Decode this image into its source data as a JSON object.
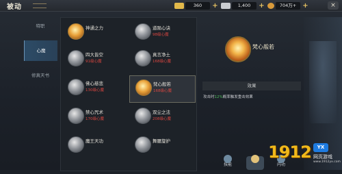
{
  "header": {
    "title": "被动",
    "resources": [
      {
        "icon": "gold-ingot-icon",
        "value": "360",
        "color": "#e2b94a"
      },
      {
        "icon": "silver-ingot-icon",
        "value": "1,400",
        "color": "#c9ccd0"
      },
      {
        "icon": "coin-bag-icon",
        "value": "704万+",
        "color": "#d89a3a"
      }
    ],
    "close_label": "×"
  },
  "sidebar": {
    "tabs": [
      {
        "label": "特职",
        "active": false
      },
      {
        "label": "心魔",
        "active": true
      },
      {
        "label": "修真天书",
        "active": false
      }
    ]
  },
  "skills": [
    {
      "name": "神通之力",
      "req": "",
      "icon": "fire-skill-icon",
      "style": "gold"
    },
    {
      "name": "道陨心诀",
      "req": "98级心魔",
      "icon": "orb-skill-icon",
      "style": "grey"
    },
    {
      "name": "四大皆空",
      "req": "91级心魔",
      "icon": "wind-skill-icon",
      "style": "grey"
    },
    {
      "name": "真言净土",
      "req": "168级心魔",
      "icon": "burst-skill-icon",
      "style": "grey"
    },
    {
      "name": "佛心慈悲",
      "req": "130级心魔",
      "icon": "lotus-skill-icon",
      "style": "grey"
    },
    {
      "name": "梵心般若",
      "req": "168级心魔",
      "icon": "flame-skill-icon",
      "style": "gold",
      "selected": true
    },
    {
      "name": "禁心咒术",
      "req": "170级心魔",
      "icon": "sigil-skill-icon",
      "style": "grey"
    },
    {
      "name": "双尘之法",
      "req": "208级心魔",
      "icon": "flower-skill-icon",
      "style": "grey"
    },
    {
      "name": "魔王天功",
      "req": "",
      "icon": "palm-skill-icon",
      "style": "grey"
    },
    {
      "name": "舞腰旋护",
      "req": "",
      "icon": "spin-skill-icon",
      "style": "grey"
    }
  ],
  "detail": {
    "name": "梵心般若",
    "effect_title": "效果",
    "effect_prefix": "攻击时",
    "effect_highlight": "12%",
    "effect_suffix": "概率触发重击效果"
  },
  "bottom": {
    "buttons": [
      "技能",
      "",
      "内功",
      "万花"
    ]
  },
  "watermark": {
    "big": "1912",
    "badge": "YX",
    "small": "网页游戏",
    "url": "www.1912yx.com"
  },
  "colors": {
    "active_tab": "#2c4b66",
    "requirement_red": "#d94640",
    "highlight_green": "#4fbf5b",
    "accent_gold": "#e7c262"
  }
}
